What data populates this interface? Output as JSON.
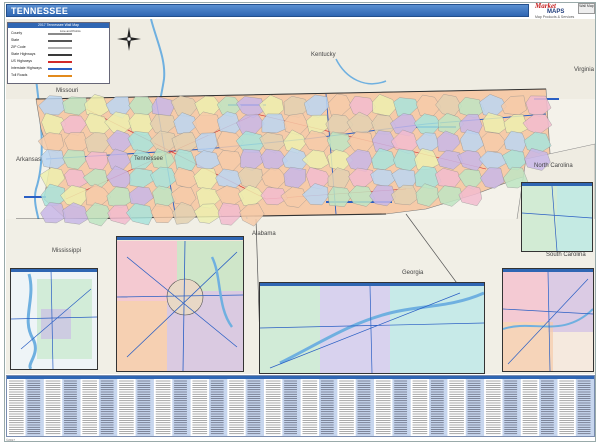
{
  "header": {
    "title": "TENNESSEE",
    "logo_line1": "Market",
    "logo_line2": "MAPS",
    "logo_line3": "Map Products & Services",
    "badge": "Wall Map"
  },
  "legend": {
    "heading": "2017 Tennessee Wall Map",
    "subheading": "Line and Points",
    "items": [
      {
        "label": "County",
        "color": "#8a8a8a"
      },
      {
        "label": "State",
        "color": "#555555"
      },
      {
        "label": "ZIP Code",
        "color": "#b0b0b0"
      },
      {
        "label": "State Highways",
        "color": "#3a3a3a"
      },
      {
        "label": "US Highways",
        "color": "#d22a2a"
      },
      {
        "label": "Interstate Highways",
        "color": "#2a5fc4"
      },
      {
        "label": "Toll Roads",
        "color": "#e28a1c"
      }
    ]
  },
  "map_labels": {
    "states": [
      "Kentucky",
      "Virginia",
      "Missouri",
      "Arkansas",
      "Tennessee",
      "North Carolina",
      "Alabama",
      "Mississippi",
      "Georgia",
      "South Carolina"
    ]
  },
  "colors": {
    "purple": "#c9b8e8",
    "peach": "#f6cba9",
    "green": "#bfe6c3",
    "yellow": "#eef0b0",
    "pink": "#f3bccf",
    "blue": "#bcd6f2",
    "teal": "#a9e4dc",
    "tan": "#e4d2b2",
    "accent": "#2f66b3",
    "water": "#6fb0e0"
  },
  "footnote": "©2017"
}
